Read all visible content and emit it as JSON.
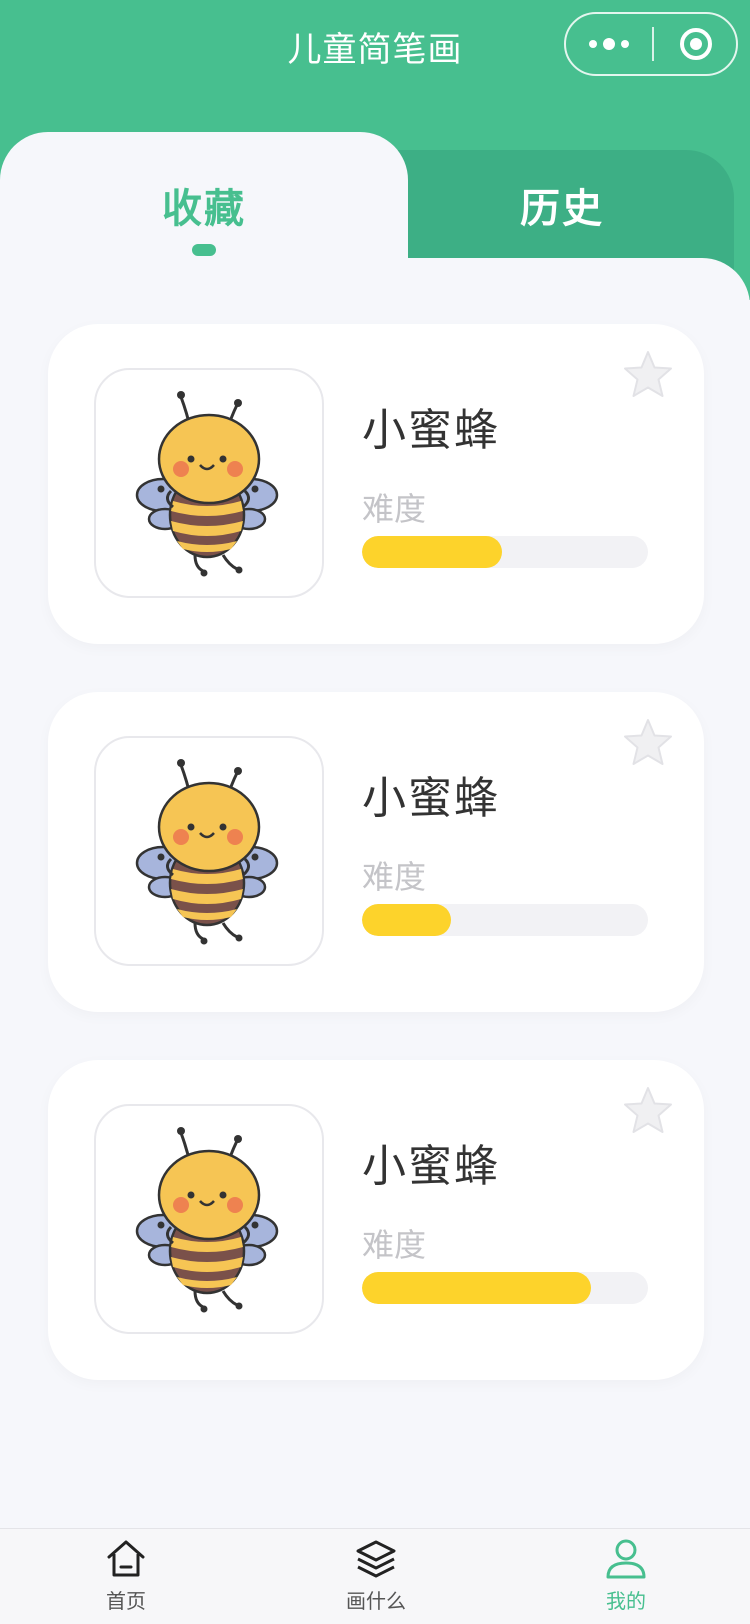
{
  "app": {
    "title": "儿童简笔画"
  },
  "colors": {
    "brand": "#47bf8f",
    "difficulty_bar": "#fdd32b",
    "track": "#f2f2f5"
  },
  "tabs": [
    {
      "label": "收藏",
      "active": true
    },
    {
      "label": "历史",
      "active": false
    }
  ],
  "cards": [
    {
      "title": "小蜜蜂",
      "difficulty_label": "难度",
      "difficulty": 0.49,
      "image": "bee-illustration",
      "icon": "star-icon"
    },
    {
      "title": "小蜜蜂",
      "difficulty_label": "难度",
      "difficulty": 0.31,
      "image": "bee-illustration",
      "icon": "star-icon"
    },
    {
      "title": "小蜜蜂",
      "difficulty_label": "难度",
      "difficulty": 0.8,
      "image": "bee-illustration",
      "icon": "star-icon"
    }
  ],
  "tabbar": [
    {
      "label": "首页",
      "icon": "home-icon",
      "active": false
    },
    {
      "label": "画什么",
      "icon": "layers-icon",
      "active": false
    },
    {
      "label": "我的",
      "icon": "user-icon",
      "active": true
    }
  ]
}
